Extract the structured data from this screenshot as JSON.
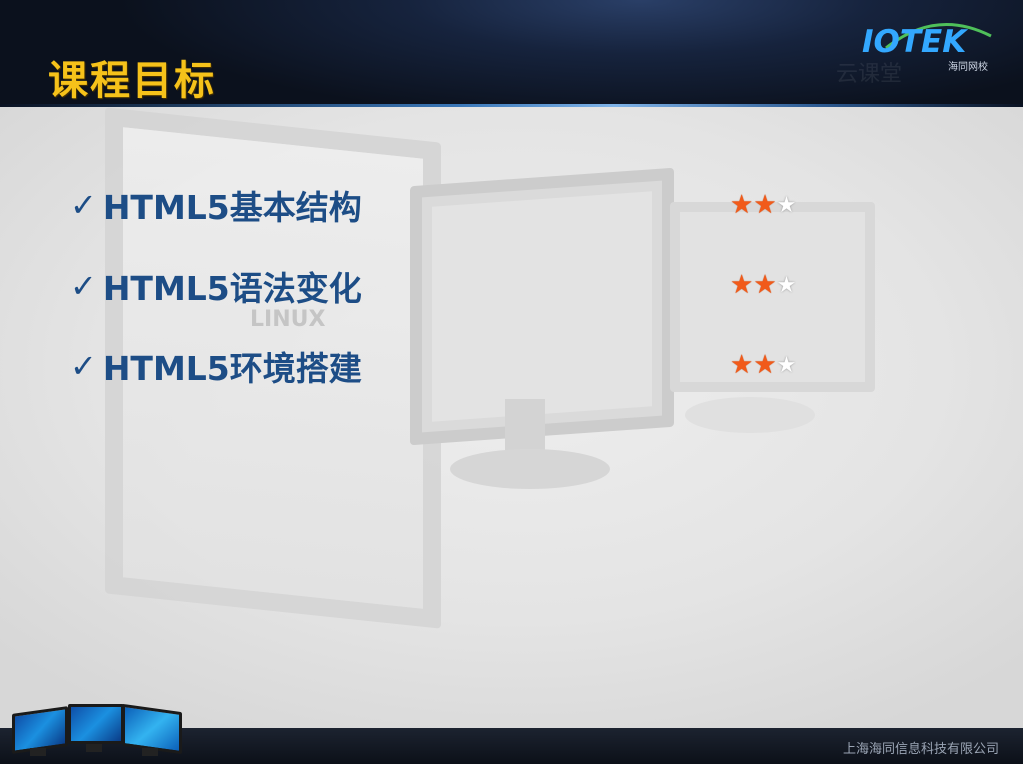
{
  "header": {
    "title": "课程目标",
    "logo_text": "IOTEK",
    "logo_sub": "海同网校",
    "cloud_mark": "云课堂"
  },
  "topics": [
    {
      "label": "HTML5基本结构",
      "rating": 2,
      "max": 5
    },
    {
      "label": "HTML5语法变化",
      "rating": 2,
      "max": 5
    },
    {
      "label": "HTML5环境搭建",
      "rating": 2,
      "max": 5
    }
  ],
  "check_glyph": "✓",
  "star_full_glyph": "★",
  "star_empty_glyph": "★",
  "background_marks": {
    "linux": "LINUX"
  },
  "footer": {
    "company": "上海海同信息科技有限公司"
  },
  "colors": {
    "title": "#f6c21a",
    "topic_text": "#1d4d86",
    "star_full": "#f15a1a",
    "logo": "#33a8ff"
  }
}
